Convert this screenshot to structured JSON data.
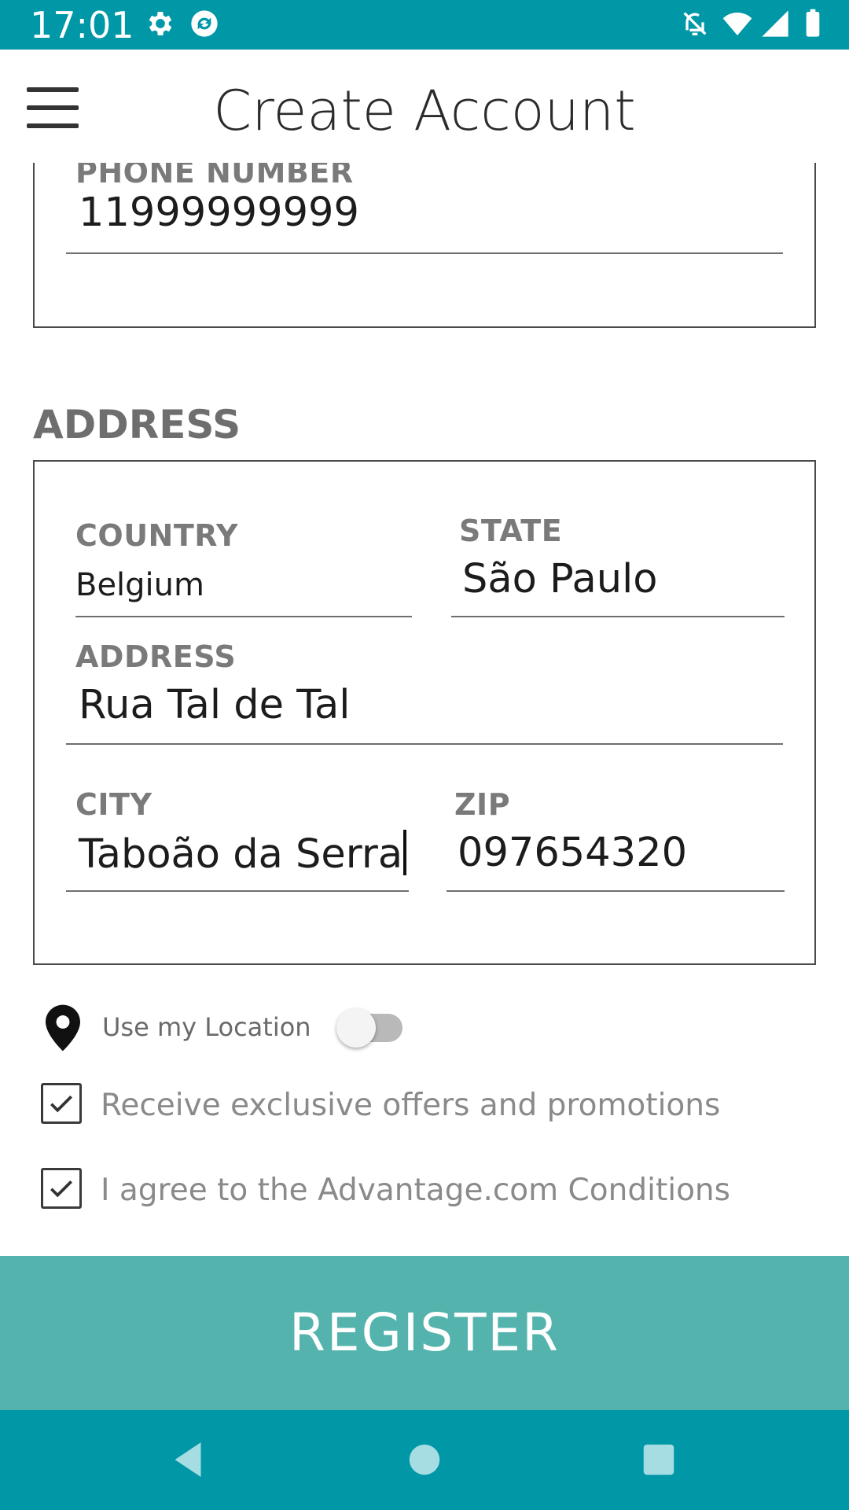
{
  "status_bar": {
    "time": "17:01",
    "icons": [
      "gear-icon",
      "sync-app-icon",
      "notifications-off-icon",
      "wifi-icon",
      "signal-icon",
      "battery-icon"
    ]
  },
  "app_bar": {
    "title": "Create Account",
    "menu_icon": "hamburger-menu-icon"
  },
  "contact": {
    "phone_label": "PHONE NUMBER",
    "phone_value": "11999999999"
  },
  "address_section": {
    "title": "ADDRESS",
    "country_label": "COUNTRY",
    "country_value": "Belgium",
    "state_label": "STATE",
    "state_value": "São Paulo",
    "address_label": "ADDRESS",
    "address_value": "Rua Tal de Tal",
    "city_label": "CITY",
    "city_value": "Taboão da Serra",
    "zip_label": "ZIP",
    "zip_value": "097654320"
  },
  "location": {
    "icon": "location-pin-icon",
    "label": "Use my Location",
    "enabled": false
  },
  "offers": {
    "label": "Receive exclusive offers and promotions",
    "checked": true
  },
  "conditions": {
    "label": "I agree to the Advantage.com Conditions",
    "checked": true
  },
  "register_label": "REGISTER",
  "colors": {
    "status_bar": "#0097a7",
    "register_button": "#54b3ad",
    "nav_bar": "#0097a7"
  },
  "nav_bar": {
    "icons": [
      "back-icon",
      "home-icon",
      "recents-icon"
    ]
  }
}
